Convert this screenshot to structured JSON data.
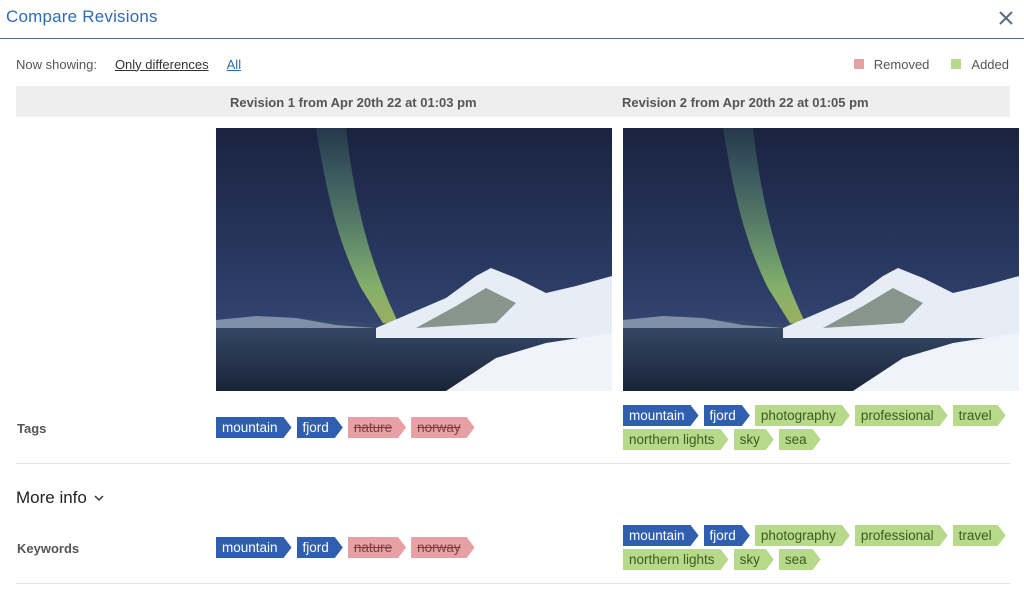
{
  "dialog": {
    "title": "Compare Revisions",
    "close_icon": "close-icon"
  },
  "filter": {
    "label": "Now showing:",
    "options": [
      "Only differences",
      "All"
    ],
    "selected": "All"
  },
  "legend": {
    "removed": {
      "label": "Removed",
      "color": "#e7a1a4"
    },
    "added": {
      "label": "Added",
      "color": "#b6d98a"
    }
  },
  "revisions": [
    {
      "header": "Revision 1 from Apr 20th 22 at 01:03 pm"
    },
    {
      "header": "Revision 2 from Apr 20th 22 at 01:05 pm"
    }
  ],
  "rows": {
    "tags": {
      "label": "Tags",
      "rev1": [
        {
          "text": "mountain",
          "state": "base"
        },
        {
          "text": "fjord",
          "state": "base"
        },
        {
          "text": "nature",
          "state": "removed"
        },
        {
          "text": "norway",
          "state": "removed"
        }
      ],
      "rev2": [
        {
          "text": "mountain",
          "state": "base"
        },
        {
          "text": "fjord",
          "state": "base"
        },
        {
          "text": "photography",
          "state": "added"
        },
        {
          "text": "professional",
          "state": "added"
        },
        {
          "text": "travel",
          "state": "added"
        },
        {
          "text": "northern lights",
          "state": "added"
        },
        {
          "text": "sky",
          "state": "added"
        },
        {
          "text": "sea",
          "state": "added"
        }
      ]
    },
    "more_info": {
      "label": "More info"
    },
    "keywords": {
      "label": "Keywords",
      "rev1": [
        {
          "text": "mountain",
          "state": "base"
        },
        {
          "text": "fjord",
          "state": "base"
        },
        {
          "text": "nature",
          "state": "removed"
        },
        {
          "text": "norway",
          "state": "removed"
        }
      ],
      "rev2": [
        {
          "text": "mountain",
          "state": "base"
        },
        {
          "text": "fjord",
          "state": "base"
        },
        {
          "text": "photography",
          "state": "added"
        },
        {
          "text": "professional",
          "state": "added"
        },
        {
          "text": "travel",
          "state": "added"
        },
        {
          "text": "northern lights",
          "state": "added"
        },
        {
          "text": "sky",
          "state": "added"
        },
        {
          "text": "sea",
          "state": "added"
        }
      ]
    }
  },
  "colors": {
    "accent": "#2d6cb5",
    "tag_base": "#2f5fae"
  }
}
